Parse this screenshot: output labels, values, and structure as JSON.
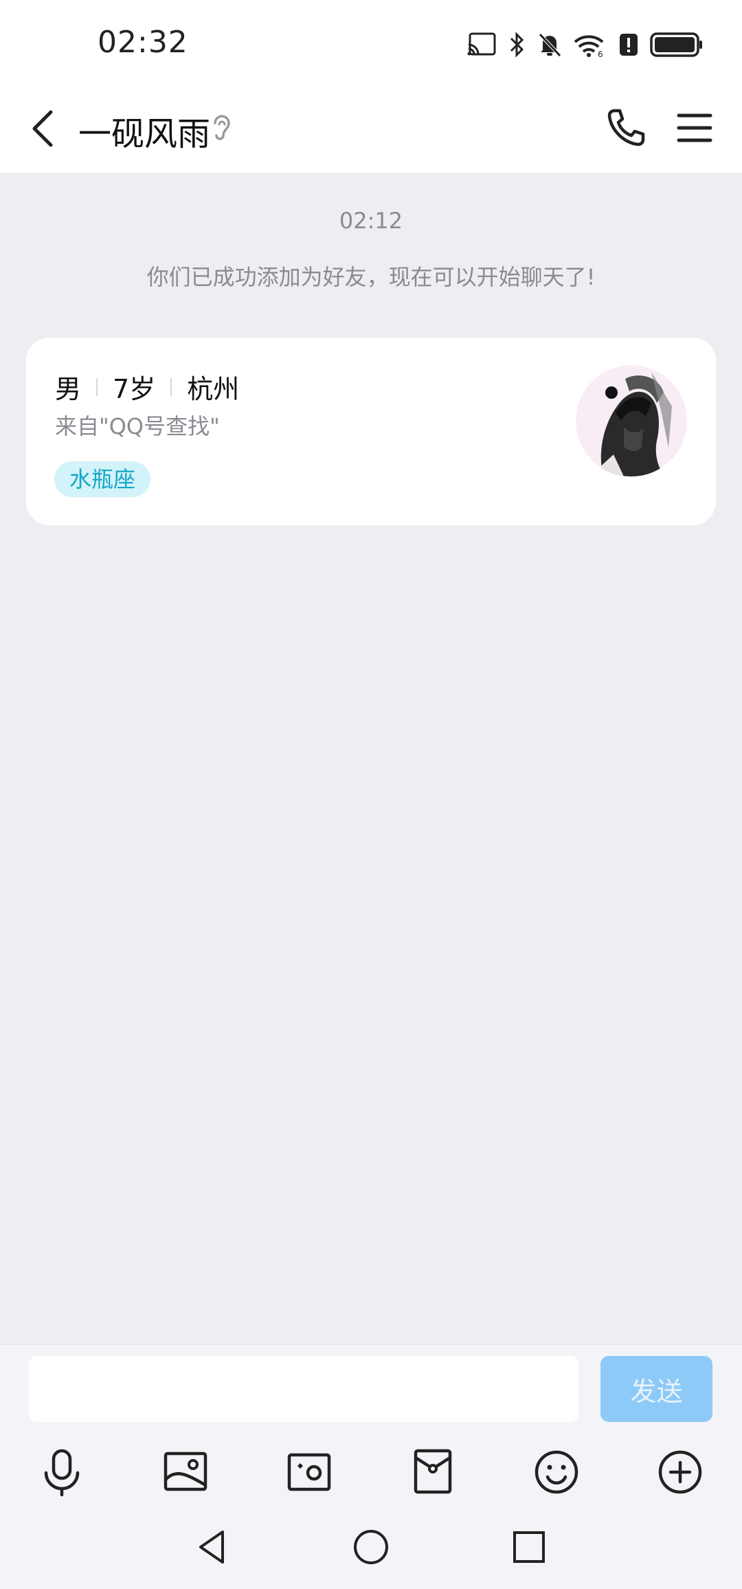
{
  "status_bar": {
    "time": "02:32"
  },
  "header": {
    "title": "一砚风雨"
  },
  "chat": {
    "timestamp": "02:12",
    "system_message": "你们已成功添加为好友，现在可以开始聊天了!"
  },
  "profile_card": {
    "gender": "男",
    "age": "7岁",
    "city": "杭州",
    "source": "来自\"QQ号查找\"",
    "tag": "水瓶座"
  },
  "composer": {
    "input_value": "",
    "send_label": "发送"
  },
  "toolbar_icons": [
    "microphone-icon",
    "image-icon",
    "camera-icon",
    "red-packet-icon",
    "emoji-icon",
    "plus-icon"
  ],
  "colors": {
    "accent_send": "#8ECAF7",
    "tag_bg": "#D3F3FA",
    "tag_text": "#15A7C6",
    "chat_bg": "#EDEDF2"
  }
}
